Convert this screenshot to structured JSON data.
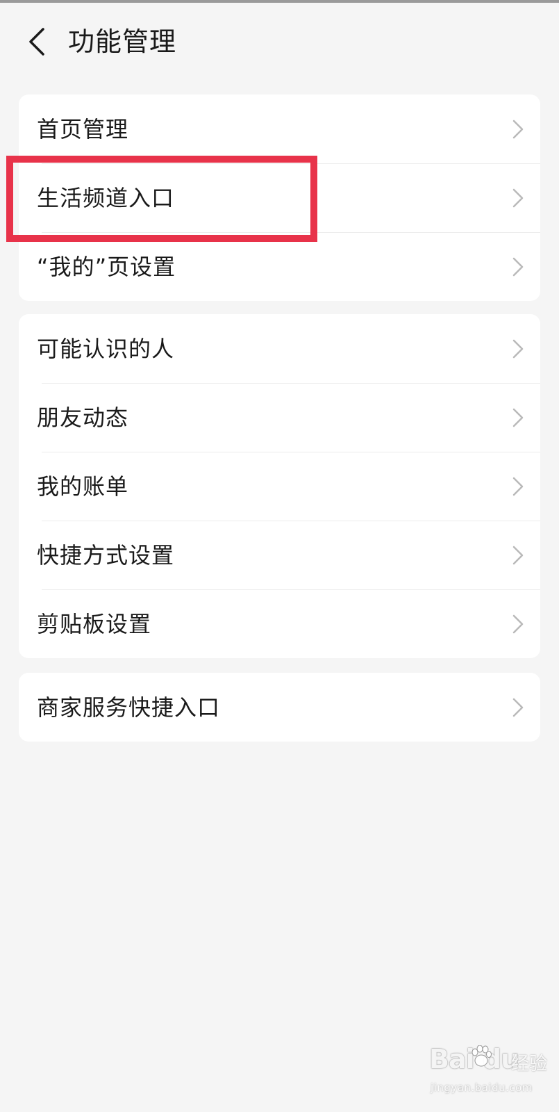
{
  "header": {
    "title": "功能管理",
    "back_icon": "chevron-left-icon"
  },
  "groups": [
    {
      "items": [
        {
          "label": "首页管理"
        },
        {
          "label": "生活频道入口",
          "highlighted": true
        },
        {
          "label": "“我的”页设置"
        }
      ]
    },
    {
      "items": [
        {
          "label": "可能认识的人"
        },
        {
          "label": "朋友动态"
        },
        {
          "label": "我的账单"
        },
        {
          "label": "快捷方式设置"
        },
        {
          "label": "剪贴板设置"
        }
      ]
    },
    {
      "items": [
        {
          "label": "商家服务快捷入口"
        }
      ]
    }
  ],
  "row_icon": "chevron-right-icon",
  "colors": {
    "background": "#f5f5f5",
    "card": "#ffffff",
    "highlight": "#e8334a",
    "chevron": "#b9b9b9"
  },
  "watermark": {
    "brand": "Bai du",
    "cn": "经验",
    "url": "jingyan.baidu.com"
  }
}
